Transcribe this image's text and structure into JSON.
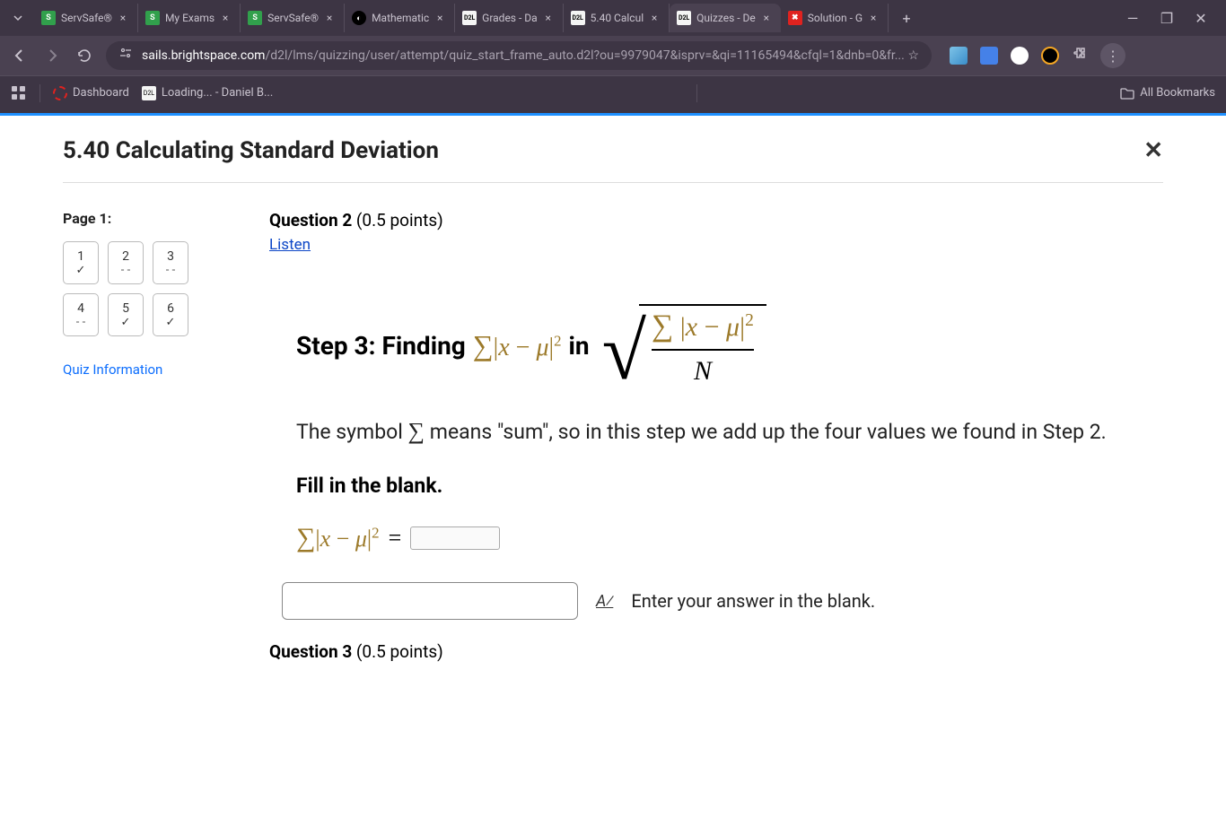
{
  "browser": {
    "tabs": [
      {
        "title": "ServSafe®",
        "fav": "s"
      },
      {
        "title": "My Exams",
        "fav": "s"
      },
      {
        "title": "ServSafe®",
        "fav": "s"
      },
      {
        "title": "Mathematic",
        "fav": "o"
      },
      {
        "title": "Grades - Da",
        "fav": "d"
      },
      {
        "title": "5.40 Calcul",
        "fav": "d"
      },
      {
        "title": "Quizzes - De",
        "fav": "d",
        "active": true
      },
      {
        "title": "Solution - G",
        "fav": "x"
      }
    ],
    "url_site": "sails.brightspace.com",
    "url_path": "/d2l/lms/quizzing/user/attempt/quiz_start_frame_auto.d2l?ou=9979047&isprv=&qi=11165494&cfql=1&dnb=0&fr...",
    "bookmarks": {
      "dashboard": "Dashboard",
      "loading": "Loading... - Daniel B...",
      "all": "All Bookmarks"
    }
  },
  "quiz": {
    "title": "5.40 Calculating Standard Deviation",
    "page_label": "Page 1:",
    "tiles": [
      {
        "n": "1",
        "status": "check"
      },
      {
        "n": "2",
        "status": "dash"
      },
      {
        "n": "3",
        "status": "dash"
      },
      {
        "n": "4",
        "status": "dash"
      },
      {
        "n": "5",
        "status": "check"
      },
      {
        "n": "6",
        "status": "check"
      }
    ],
    "info_link": "Quiz Information",
    "question_num": "Question 2",
    "question_pts": " (0.5 points)",
    "listen": "Listen",
    "step_label": "Step 3: Finding ",
    "expr_inline": "∑ |x − μ|²",
    "in_word": " in ",
    "frac_top": "∑ |x − μ|²",
    "frac_bot": "N",
    "body_text_1": "The symbol ",
    "body_sigma": "∑",
    "body_text_2": " means \"sum\", so in this step we add up the four values we found in Step 2.",
    "fill_label": "Fill in the blank.",
    "eq_left": "∑|x − μ|²",
    "eq_sign": " = ",
    "answer_hint": "Enter your answer in the blank.",
    "q3_num": "Question 3",
    "q3_pts": " (0.5 points)"
  }
}
